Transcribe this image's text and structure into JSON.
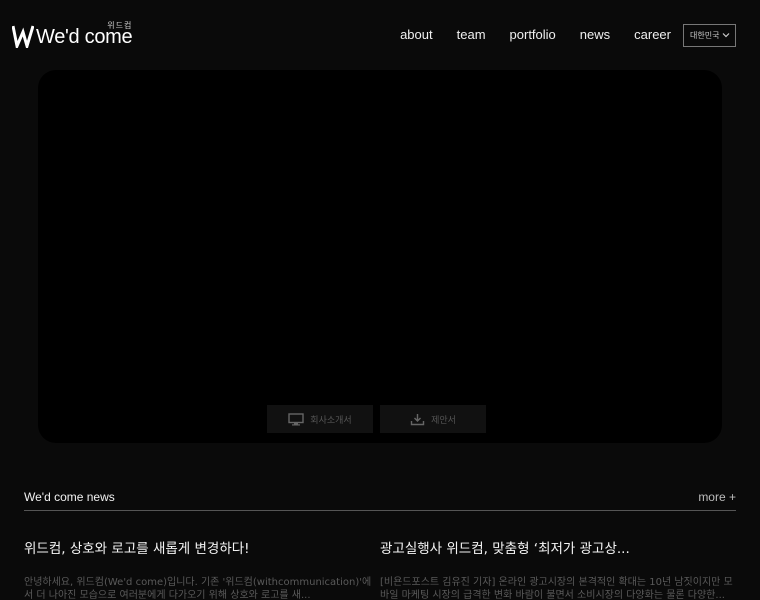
{
  "header": {
    "logo_text": "We'd come",
    "logo_korean": "위드컴",
    "nav": [
      "about",
      "team",
      "portfolio",
      "news",
      "career"
    ],
    "language": "대한민국"
  },
  "hero": {
    "buttons": [
      {
        "label": "회사소개서",
        "icon": "monitor-icon"
      },
      {
        "label": "제안서",
        "icon": "download-icon"
      }
    ]
  },
  "news": {
    "title": "We'd come news",
    "more": "more +",
    "articles": [
      {
        "title": "위드컴, 상호와 로고를 새롭게 변경하다!",
        "excerpt": "안녕하세요, 위드컴(We'd come)입니다. 기존 '위드컴(withcommunication)'에서 더 나아진 모습으로 여러분에게 다가오기 위해 상호와 로고를 새..."
      },
      {
        "title": "광고실행사 위드컴, 맞춤형 ‘최저가 광고상...",
        "excerpt": "[비욘드포스트 김유진 기자] 온라인 광고시장의 본격적인 확대는 10년 남짓이지만 모바일 마케팅 시장의 급격한 변화 바람이 불면서 소비시장의 다양화는 물론 다양한..."
      }
    ]
  },
  "colors": {
    "background": "#0a0a0a",
    "hero": "#000000",
    "text": "#f0f0f0"
  }
}
